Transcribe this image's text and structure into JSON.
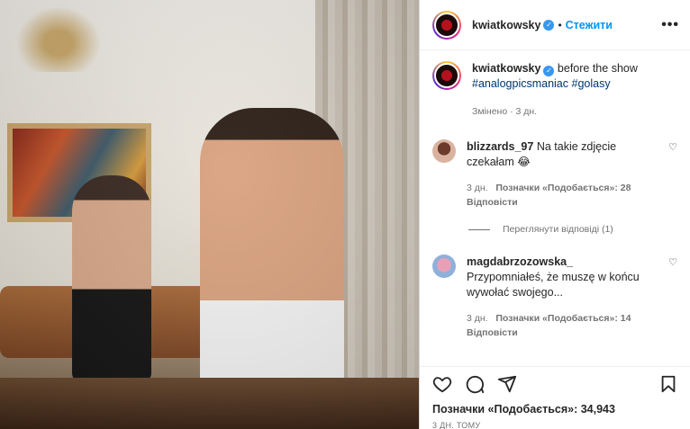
{
  "post": {
    "username": "kwiatkowsky",
    "dot": "•",
    "follow_label": "Стежити",
    "more_label": "•••"
  },
  "caption": {
    "username": "kwiatkowsky",
    "text": "before the show",
    "hashtags": "#analogpicsmaniac #golasy",
    "edited": "Змінено · 3 дн."
  },
  "comments": [
    {
      "username": "blizzards_97",
      "text": "Na takie zdjęcie czekałam 😂",
      "time": "3 дн.",
      "likes": "Позначки «Подобається»: 28",
      "reply": "Відповісти",
      "view_replies": "Переглянути відповіді (1)"
    },
    {
      "username": "magdabrzozowska_",
      "text": "Przypomniałeś, że muszę w końcu wywołać swojego...",
      "time": "3 дн.",
      "likes": "Позначки «Подобається»: 14",
      "reply": "Відповісти"
    }
  ],
  "footer": {
    "likes": "Позначки «Подобається»: 34,943",
    "time": "3 ДН. ТОМУ"
  },
  "icons": {
    "like": "heart-icon",
    "comment": "comment-icon",
    "share": "share-icon",
    "save": "bookmark-icon",
    "verified": "verified-badge-icon"
  },
  "colors": {
    "follow": "#0095f6",
    "verified": "#3897f0",
    "hashtag": "#00376b",
    "muted": "#737373"
  }
}
